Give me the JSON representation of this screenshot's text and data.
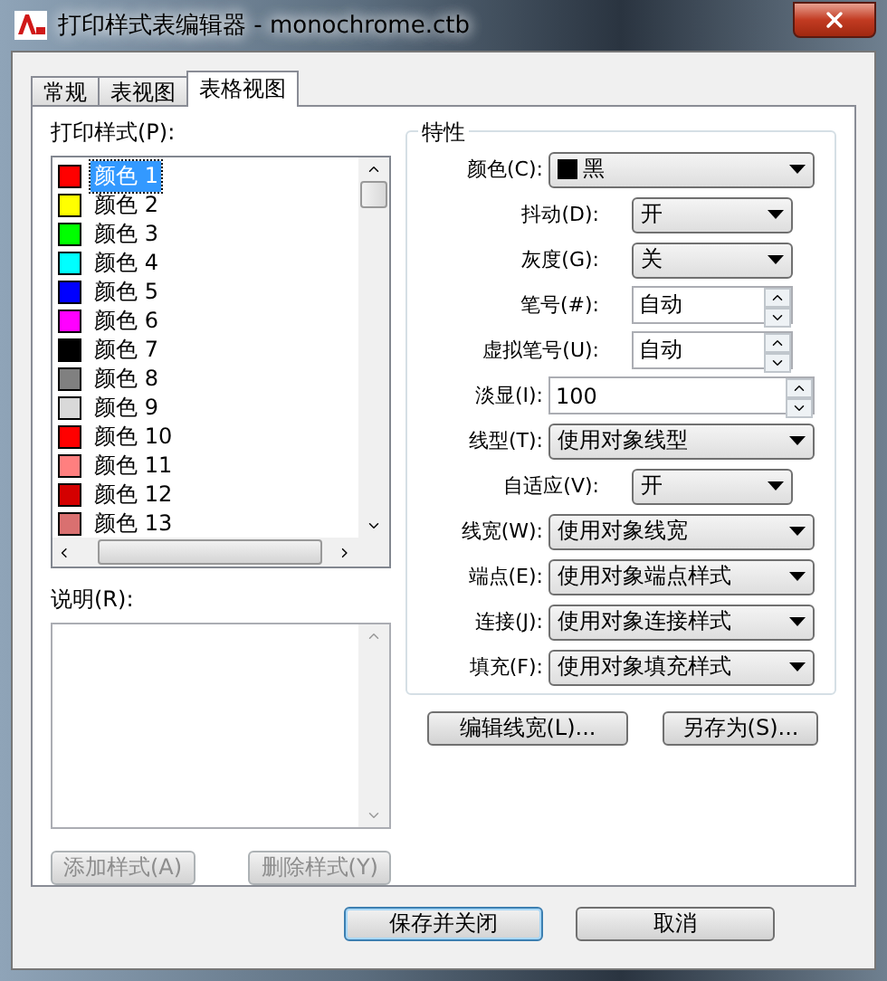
{
  "window": {
    "title": "打印样式表编辑器 - monochrome.ctb"
  },
  "tabs": [
    {
      "label": "常规",
      "selected": false
    },
    {
      "label": "表视图",
      "selected": false
    },
    {
      "label": "表格视图",
      "selected": true
    }
  ],
  "styles_list": {
    "label": "打印样式(P):",
    "items": [
      {
        "name": "颜色 1",
        "color": "#ff0000",
        "selected": true
      },
      {
        "name": "颜色 2",
        "color": "#ffff00",
        "selected": false
      },
      {
        "name": "颜色 3",
        "color": "#00ff00",
        "selected": false
      },
      {
        "name": "颜色 4",
        "color": "#00ffff",
        "selected": false
      },
      {
        "name": "颜色 5",
        "color": "#0000ff",
        "selected": false
      },
      {
        "name": "颜色 6",
        "color": "#ff00ff",
        "selected": false
      },
      {
        "name": "颜色 7",
        "color": "#000000",
        "selected": false
      },
      {
        "name": "颜色 8",
        "color": "#808080",
        "selected": false
      },
      {
        "name": "颜色 9",
        "color": "#d9d9d9",
        "selected": false
      },
      {
        "name": "颜色 10",
        "color": "#ff0000",
        "selected": false
      },
      {
        "name": "颜色 11",
        "color": "#ff7f7f",
        "selected": false
      },
      {
        "name": "颜色 12",
        "color": "#d40000",
        "selected": false
      },
      {
        "name": "颜色 13",
        "color": "#d97070",
        "selected": false
      }
    ]
  },
  "description": {
    "label": "说明(R):"
  },
  "list_buttons": [
    {
      "label": "添加样式(A)",
      "disabled": true
    },
    {
      "label": "删除样式(Y)",
      "disabled": true
    }
  ],
  "properties": {
    "title": "特性",
    "fields": [
      {
        "kind": "colorpicker",
        "label": "颜色(C):",
        "value": "黑",
        "color": "#000000"
      },
      {
        "kind": "combo",
        "label": "抖动(D):",
        "value": "开"
      },
      {
        "kind": "combo",
        "label": "灰度(G):",
        "value": "关"
      },
      {
        "kind": "spinner",
        "label": "笔号(#):",
        "value": "自动"
      },
      {
        "kind": "spinner",
        "label": "虚拟笔号(U):",
        "value": "自动"
      },
      {
        "kind": "widespinner",
        "label": "淡显(I):",
        "value": "100"
      },
      {
        "kind": "widecombo",
        "label": "线型(T):",
        "value": "使用对象线型"
      },
      {
        "kind": "combo",
        "label": "自适应(V):",
        "value": "开"
      },
      {
        "kind": "widecombo",
        "label": "线宽(W):",
        "value": "使用对象线宽"
      },
      {
        "kind": "widecombo",
        "label": "端点(E):",
        "value": "使用对象端点样式"
      },
      {
        "kind": "widecombo",
        "label": "连接(J):",
        "value": "使用对象连接样式"
      },
      {
        "kind": "widecombo",
        "label": "填充(F):",
        "value": "使用对象填充样式"
      }
    ]
  },
  "property_buttons": [
    {
      "label": "编辑线宽(L)..."
    },
    {
      "label": "另存为(S)..."
    }
  ],
  "footer_buttons": [
    {
      "label": "保存并关闭",
      "default": true
    },
    {
      "label": "取消",
      "default": false
    }
  ]
}
